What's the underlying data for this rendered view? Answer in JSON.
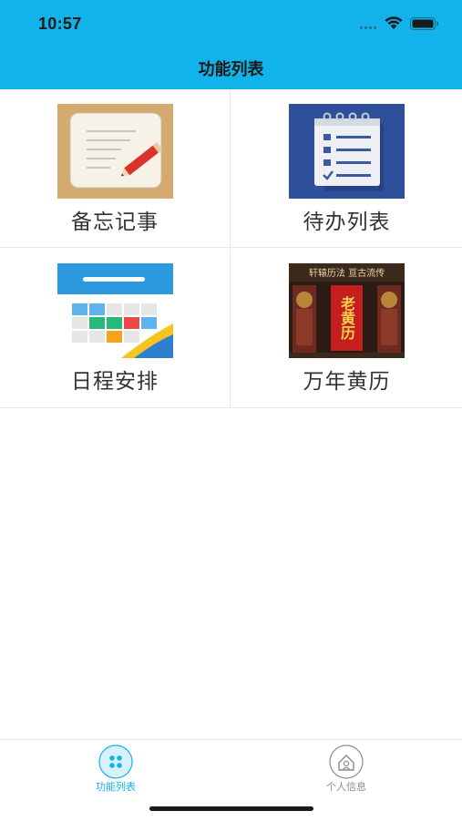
{
  "status_bar": {
    "time": "10:57",
    "icons": [
      "signal-dots-icon",
      "wifi-icon",
      "battery-icon"
    ]
  },
  "nav": {
    "title": "功能列表"
  },
  "grid": {
    "items": [
      {
        "label": "备忘记事",
        "icon": "memo-notepad-pencil-icon"
      },
      {
        "label": "待办列表",
        "icon": "todo-checklist-icon"
      },
      {
        "label": "日程安排",
        "icon": "calendar-schedule-icon"
      },
      {
        "label": "万年黄历",
        "icon": "almanac-poster-icon",
        "poster_text": {
          "top": "轩辕历法 亘古流传",
          "main": "老黄历"
        }
      }
    ]
  },
  "tabbar": {
    "tabs": [
      {
        "label": "功能列表",
        "icon": "grid-dots-icon",
        "active": true
      },
      {
        "label": "个人信息",
        "icon": "person-profile-icon",
        "active": false
      }
    ]
  },
  "colors": {
    "header_bg": "#12b2ea",
    "active_tab": "#12b2ea",
    "inactive_tab": "#8c8c8c",
    "label_text": "#333333"
  }
}
